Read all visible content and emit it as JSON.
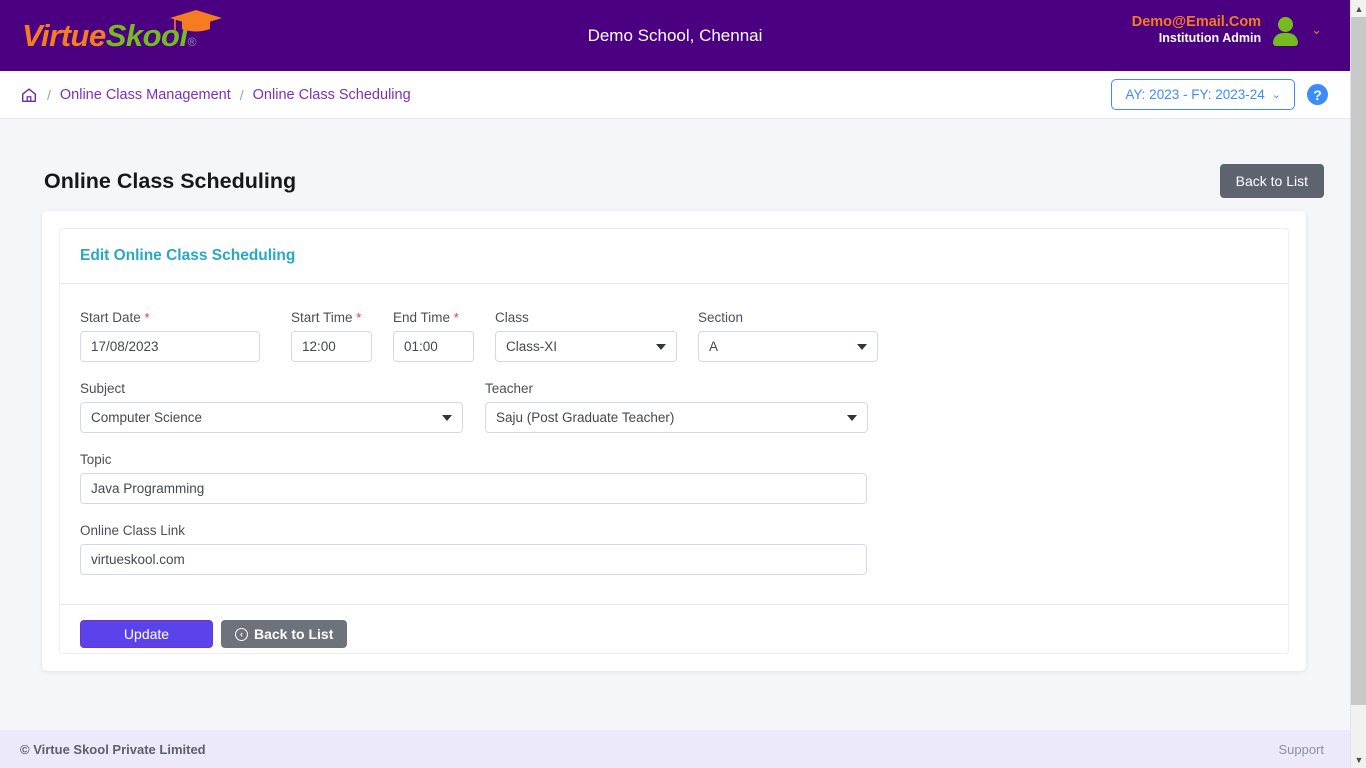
{
  "header": {
    "logo_virtue": "Virtue",
    "logo_skool": "Skool",
    "logo_reg": "®",
    "school_title": "Demo School, Chennai",
    "user_email": "Demo@Email.Com",
    "user_role": "Institution Admin",
    "caret": "⌄",
    "brand_orange": "#f57c20",
    "brand_green": "#76bc21",
    "header_purple": "#4b0082"
  },
  "breadcrumb": {
    "home_icon": "home-icon",
    "sep": "/",
    "items": [
      {
        "label": "Online Class Management"
      },
      {
        "label": "Online Class Scheduling"
      }
    ],
    "academic_year": "AY: 2023 - FY: 2023-24",
    "ay_caret": "⌄",
    "help": "?",
    "accent_blue": "#3d8bfd",
    "crumb_purple": "#7b2fbe"
  },
  "page": {
    "title": "Online Class Scheduling",
    "back_to_list_top": "Back to List"
  },
  "card": {
    "title": "Edit Online Class Scheduling",
    "title_color": "#29a8c4"
  },
  "form": {
    "start_date": {
      "label": "Start Date",
      "required": "*",
      "value": "17/08/2023"
    },
    "start_time": {
      "label": "Start Time",
      "required": "*",
      "value": "12:00"
    },
    "end_time": {
      "label": "End Time",
      "required": "*",
      "value": "01:00"
    },
    "class": {
      "label": "Class",
      "value": "Class-XI"
    },
    "section": {
      "label": "Section",
      "value": "A"
    },
    "subject": {
      "label": "Subject",
      "value": "Computer Science"
    },
    "teacher": {
      "label": "Teacher",
      "value": "Saju (Post Graduate Teacher)"
    },
    "topic": {
      "label": "Topic",
      "value": "Java Programming"
    },
    "online_class_link": {
      "label": "Online Class Link",
      "value": "virtueskool.com"
    }
  },
  "actions": {
    "update": "Update",
    "back_to_list": "Back to List",
    "back_arrow": "‹",
    "update_color": "#5b43ec"
  },
  "footer": {
    "copyright": "© Virtue Skool Private Limited",
    "support": "Support"
  },
  "scrollbar": {
    "up": "▲",
    "down": "▼"
  }
}
